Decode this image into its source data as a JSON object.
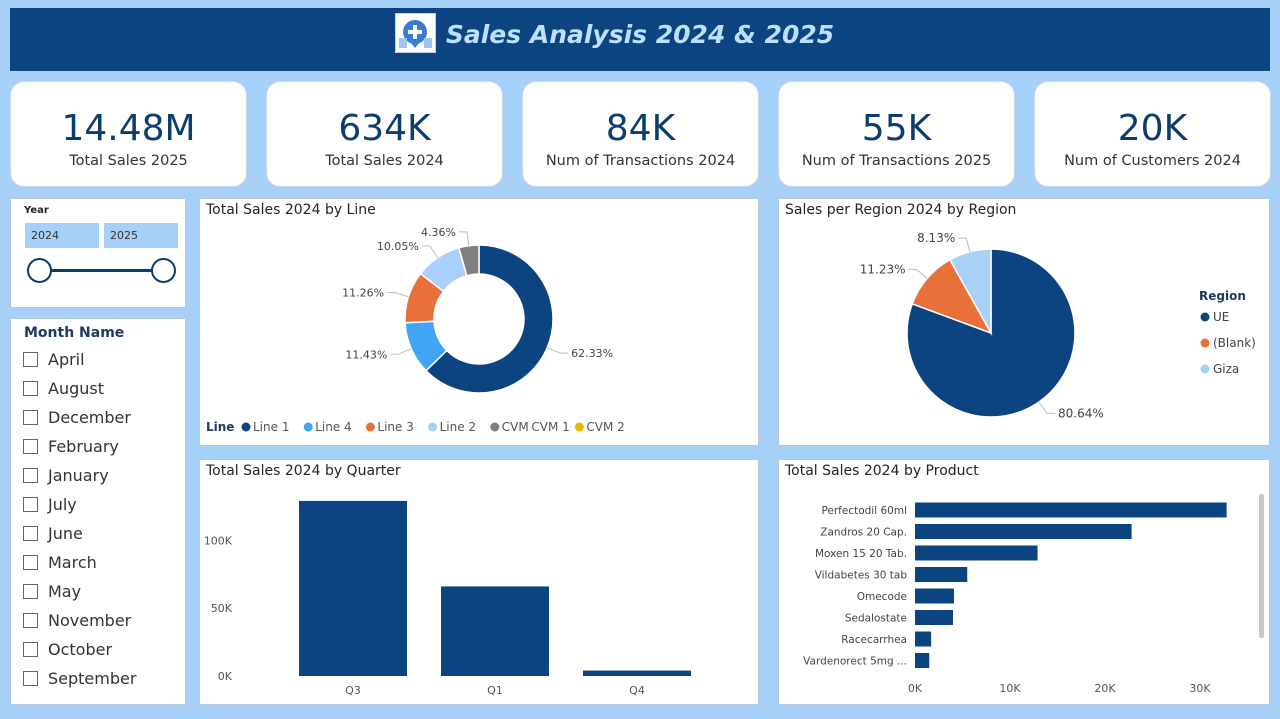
{
  "header": {
    "title": "Sales Analysis 2024 & 2025"
  },
  "kpis": [
    {
      "value": "14.48M",
      "label": "Total Sales 2025"
    },
    {
      "value": "634K",
      "label": "Total Sales 2024"
    },
    {
      "value": "84K",
      "label": "Num of Transactions 2024"
    },
    {
      "value": "55K",
      "label": "Num of Transactions 2025"
    },
    {
      "value": "20K",
      "label": "Num of Customers 2024"
    }
  ],
  "year_slicer": {
    "title": "Year",
    "from": "2024",
    "to": "2025"
  },
  "month_slicer": {
    "title": "Month Name",
    "items": [
      "April",
      "August",
      "December",
      "February",
      "January",
      "July",
      "June",
      "March",
      "May",
      "November",
      "October",
      "September"
    ]
  },
  "colors": {
    "navy": "#0b4480",
    "blue": "#41a5f5",
    "orange": "#e8703a",
    "light": "#a8d0f8",
    "gray": "#808080",
    "yellow": "#e6b800"
  },
  "chart_data": [
    {
      "type": "pie",
      "title": "Total Sales 2024 by Line",
      "legend_title": "Line",
      "legend": [
        "Line 1",
        "Line 4",
        "Line 3",
        "Line 2",
        "CVM",
        "CVM 1",
        "CVM 2"
      ],
      "slices": [
        {
          "name": "Line 1",
          "value": 62.33,
          "label": "62.33%",
          "color": "#0b4480"
        },
        {
          "name": "Line 4",
          "value": 11.43,
          "label": "11.43%",
          "color": "#41a5f5"
        },
        {
          "name": "Line 3",
          "value": 11.26,
          "label": "11.26%",
          "color": "#e8703a"
        },
        {
          "name": "Line 2",
          "value": 10.05,
          "label": "10.05%",
          "color": "#a8d0f8"
        },
        {
          "name": "CVM",
          "value": 4.36,
          "label": "4.36%",
          "color": "#808080"
        },
        {
          "name": "CVM 1",
          "value": 0.0,
          "label": "",
          "color": "#0b4480"
        },
        {
          "name": "CVM 2",
          "value": 0.0,
          "label": "",
          "color": "#e6b800"
        }
      ]
    },
    {
      "type": "pie",
      "title": "Sales per Region 2024 by Region",
      "legend_title": "Region",
      "legend": [
        "UE",
        "(Blank)",
        "Giza"
      ],
      "slices": [
        {
          "name": "UE",
          "value": 80.64,
          "label": "80.64%",
          "color": "#0b4480"
        },
        {
          "name": "(Blank)",
          "value": 11.23,
          "label": "11.23%",
          "color": "#e8703a"
        },
        {
          "name": "Giza",
          "value": 8.13,
          "label": "8.13%",
          "color": "#a8d0f8"
        }
      ]
    },
    {
      "type": "bar",
      "title": "Total Sales 2024 by Quarter",
      "categories": [
        "Q3",
        "Q1",
        "Q4"
      ],
      "values": [
        129000,
        66000,
        4000
      ],
      "yticks": [
        "0K",
        "50K",
        "100K"
      ],
      "ylim": [
        0,
        140000
      ]
    },
    {
      "type": "bar",
      "orientation": "horizontal",
      "title": "Total Sales 2024 by Product",
      "categories": [
        "Perfectodil 60ml",
        "Zandros 20 Cap.",
        "Moxen 15 20 Tab.",
        "Vildabetes 30 tab",
        "Omecode",
        "Sedalostate",
        "Racecarrhea",
        "Vardenorect 5mg ..."
      ],
      "values": [
        32800,
        22800,
        12900,
        5500,
        4100,
        4000,
        1700,
        1500
      ],
      "xticks": [
        "0K",
        "10K",
        "20K",
        "30K"
      ],
      "xlim": [
        0,
        34000
      ]
    }
  ]
}
